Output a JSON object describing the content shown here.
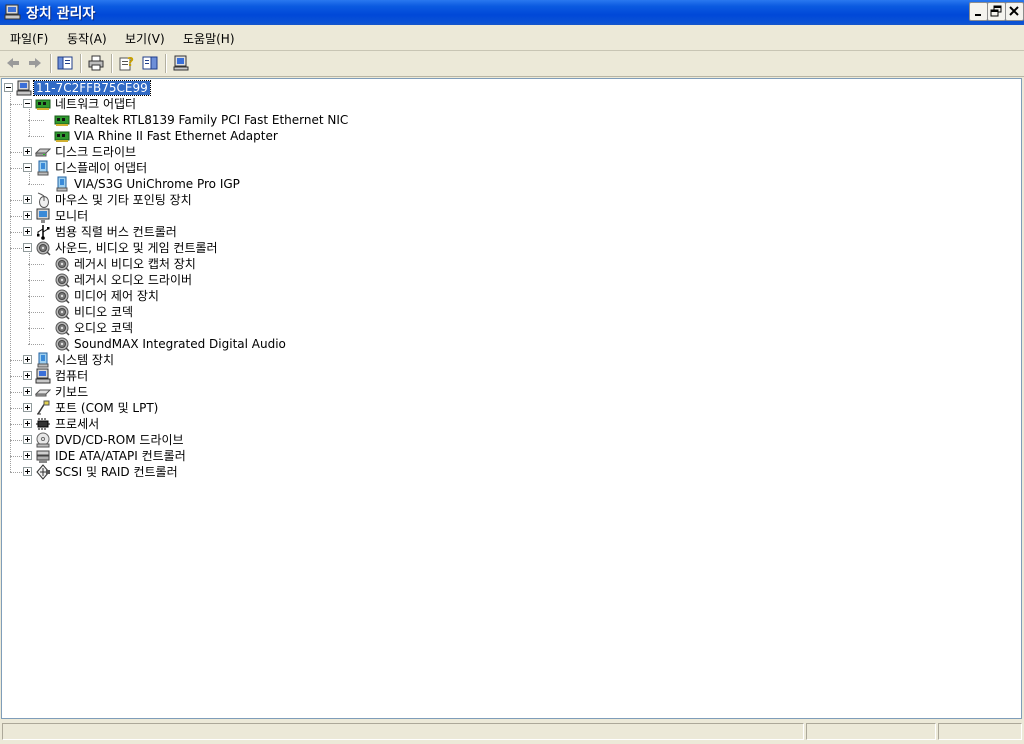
{
  "window": {
    "title": "장치 관리자",
    "icon": "computer-manager-icon",
    "accent_color": "#0a52d6"
  },
  "menu": {
    "items": [
      {
        "label": "파일(F)"
      },
      {
        "label": "동작(A)"
      },
      {
        "label": "보기(V)"
      },
      {
        "label": "도움말(H)"
      }
    ]
  },
  "toolbar": {
    "buttons": [
      "back-arrow-icon",
      "forward-arrow-icon",
      "show-hide-tree-icon",
      "print-icon",
      "properties-help-icon",
      "view-toggle-icon",
      "scan-hardware-icon"
    ]
  },
  "tree": {
    "root": {
      "label": "11-7C2FFB75CE99",
      "icon": "computer-icon",
      "selected": true
    },
    "nodes": [
      {
        "label": "네트워크 어댑터",
        "icon": "network-card-icon",
        "expanded": true,
        "children": [
          {
            "label": "Realtek RTL8139 Family PCI Fast Ethernet NIC",
            "icon": "network-card-icon"
          },
          {
            "label": "VIA Rhine II Fast Ethernet Adapter",
            "icon": "network-card-icon"
          }
        ]
      },
      {
        "label": "디스크 드라이브",
        "icon": "disk-drive-icon",
        "expanded": false
      },
      {
        "label": "디스플레이 어댑터",
        "icon": "display-adapter-icon",
        "expanded": true,
        "children": [
          {
            "label": "VIA/S3G UniChrome Pro IGP",
            "icon": "display-adapter-icon"
          }
        ]
      },
      {
        "label": "마우스 및 기타 포인팅 장치",
        "icon": "mouse-icon",
        "expanded": false
      },
      {
        "label": "모니터",
        "icon": "monitor-icon",
        "expanded": false
      },
      {
        "label": "범용 직렬 버스 컨트롤러",
        "icon": "usb-icon",
        "expanded": false
      },
      {
        "label": "사운드, 비디오 및 게임 컨트롤러",
        "icon": "speaker-icon",
        "expanded": true,
        "children": [
          {
            "label": "레거시 비디오 캡처 장치",
            "icon": "speaker-icon"
          },
          {
            "label": "레거시 오디오 드라이버",
            "icon": "speaker-icon"
          },
          {
            "label": "미디어 제어 장치",
            "icon": "speaker-icon"
          },
          {
            "label": "비디오 코덱",
            "icon": "speaker-icon"
          },
          {
            "label": "오디오 코덱",
            "icon": "speaker-icon"
          },
          {
            "label": "SoundMAX Integrated Digital Audio",
            "icon": "speaker-icon"
          }
        ]
      },
      {
        "label": "시스템 장치",
        "icon": "system-device-icon",
        "expanded": false
      },
      {
        "label": "컴퓨터",
        "icon": "computer-icon",
        "expanded": false
      },
      {
        "label": "키보드",
        "icon": "keyboard-icon",
        "expanded": false
      },
      {
        "label": "포트 (COM 및 LPT)",
        "icon": "port-icon",
        "expanded": false
      },
      {
        "label": "프로세서",
        "icon": "processor-icon",
        "expanded": false
      },
      {
        "label": "DVD/CD-ROM 드라이브",
        "icon": "cdrom-icon",
        "expanded": false
      },
      {
        "label": "IDE ATA/ATAPI 컨트롤러",
        "icon": "ide-controller-icon",
        "expanded": false
      },
      {
        "label": "SCSI 및 RAID 컨트롤러",
        "icon": "scsi-controller-icon",
        "expanded": false
      }
    ]
  }
}
